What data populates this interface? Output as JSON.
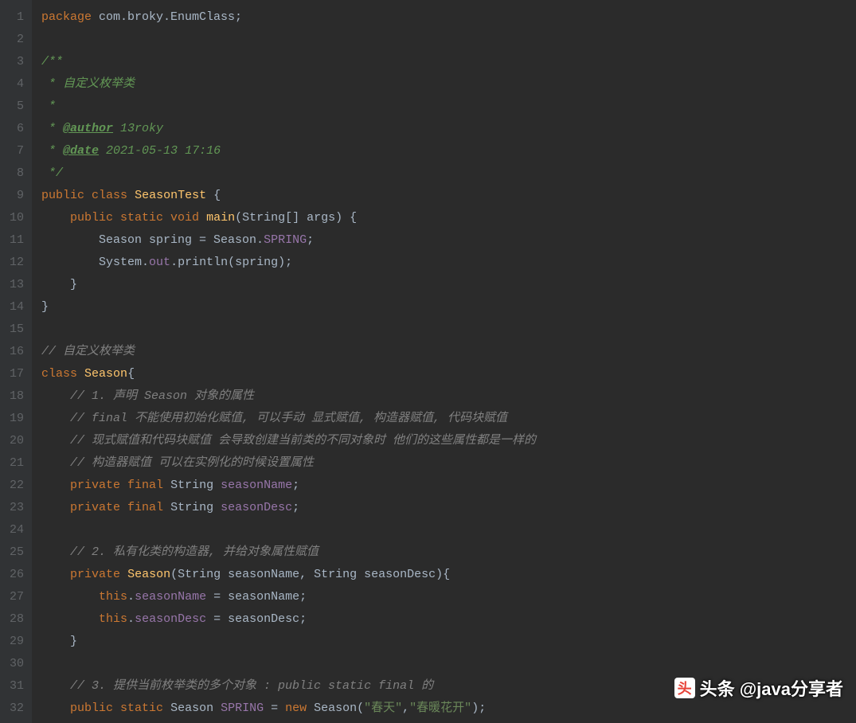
{
  "lines": [
    {
      "n": 1,
      "tokens": [
        {
          "c": "kw",
          "t": "package"
        },
        {
          "c": "pun",
          "t": " com.broky.EnumClass;"
        }
      ]
    },
    {
      "n": 2,
      "tokens": []
    },
    {
      "n": 3,
      "tokens": [
        {
          "c": "doc",
          "t": "/**"
        }
      ]
    },
    {
      "n": 4,
      "tokens": [
        {
          "c": "doc",
          "t": " * 自定义枚举类"
        }
      ]
    },
    {
      "n": 5,
      "tokens": [
        {
          "c": "doc",
          "t": " *"
        }
      ]
    },
    {
      "n": 6,
      "tokens": [
        {
          "c": "doc",
          "t": " * "
        },
        {
          "c": "doctag",
          "t": "@author"
        },
        {
          "c": "doc",
          "t": " 13roky"
        }
      ]
    },
    {
      "n": 7,
      "tokens": [
        {
          "c": "doc",
          "t": " * "
        },
        {
          "c": "doctag",
          "t": "@date"
        },
        {
          "c": "doc",
          "t": " 2021-05-13 17:16"
        }
      ]
    },
    {
      "n": 8,
      "tokens": [
        {
          "c": "doc",
          "t": " */"
        }
      ]
    },
    {
      "n": 9,
      "tokens": [
        {
          "c": "kw",
          "t": "public class"
        },
        {
          "c": "pun",
          "t": " "
        },
        {
          "c": "cls",
          "t": "SeasonTest"
        },
        {
          "c": "pun",
          "t": " {"
        }
      ]
    },
    {
      "n": 10,
      "tokens": [
        {
          "c": "pun",
          "t": "    "
        },
        {
          "c": "kw",
          "t": "public static void"
        },
        {
          "c": "pun",
          "t": " "
        },
        {
          "c": "fn",
          "t": "main"
        },
        {
          "c": "pun",
          "t": "(String[] args) {"
        }
      ]
    },
    {
      "n": 11,
      "tokens": [
        {
          "c": "pun",
          "t": "        Season spring = Season."
        },
        {
          "c": "field",
          "t": "SPRING"
        },
        {
          "c": "pun",
          "t": ";"
        }
      ]
    },
    {
      "n": 12,
      "tokens": [
        {
          "c": "pun",
          "t": "        System."
        },
        {
          "c": "field",
          "t": "out"
        },
        {
          "c": "pun",
          "t": ".println(spring);"
        }
      ]
    },
    {
      "n": 13,
      "tokens": [
        {
          "c": "pun",
          "t": "    }"
        }
      ]
    },
    {
      "n": 14,
      "tokens": [
        {
          "c": "pun",
          "t": "}"
        }
      ]
    },
    {
      "n": 15,
      "tokens": []
    },
    {
      "n": 16,
      "tokens": [
        {
          "c": "cmt",
          "t": "// 自定义枚举类"
        }
      ]
    },
    {
      "n": 17,
      "tokens": [
        {
          "c": "kw",
          "t": "class"
        },
        {
          "c": "pun",
          "t": " "
        },
        {
          "c": "cls",
          "t": "Season"
        },
        {
          "c": "pun",
          "t": "{"
        }
      ]
    },
    {
      "n": 18,
      "tokens": [
        {
          "c": "pun",
          "t": "    "
        },
        {
          "c": "cmt",
          "t": "// 1. 声明 Season 对象的属性"
        }
      ]
    },
    {
      "n": 19,
      "tokens": [
        {
          "c": "pun",
          "t": "    "
        },
        {
          "c": "cmt",
          "t": "// final 不能使用初始化赋值, 可以手动 显式赋值, 构造器赋值, 代码块赋值"
        }
      ]
    },
    {
      "n": 20,
      "tokens": [
        {
          "c": "pun",
          "t": "    "
        },
        {
          "c": "cmt",
          "t": "// 现式赋值和代码块赋值 会导致创建当前类的不同对象时 他们的这些属性都是一样的"
        }
      ]
    },
    {
      "n": 21,
      "tokens": [
        {
          "c": "pun",
          "t": "    "
        },
        {
          "c": "cmt",
          "t": "// 构造器赋值 可以在实例化的时候设置属性"
        }
      ]
    },
    {
      "n": 22,
      "tokens": [
        {
          "c": "pun",
          "t": "    "
        },
        {
          "c": "kw",
          "t": "private final"
        },
        {
          "c": "pun",
          "t": " String "
        },
        {
          "c": "field",
          "t": "seasonName"
        },
        {
          "c": "pun",
          "t": ";"
        }
      ]
    },
    {
      "n": 23,
      "tokens": [
        {
          "c": "pun",
          "t": "    "
        },
        {
          "c": "kw",
          "t": "private final"
        },
        {
          "c": "pun",
          "t": " String "
        },
        {
          "c": "field",
          "t": "seasonDesc"
        },
        {
          "c": "pun",
          "t": ";"
        }
      ]
    },
    {
      "n": 24,
      "tokens": []
    },
    {
      "n": 25,
      "tokens": [
        {
          "c": "pun",
          "t": "    "
        },
        {
          "c": "cmt",
          "t": "// 2. 私有化类的构造器, 并给对象属性赋值"
        }
      ]
    },
    {
      "n": 26,
      "tokens": [
        {
          "c": "pun",
          "t": "    "
        },
        {
          "c": "kw",
          "t": "private"
        },
        {
          "c": "pun",
          "t": " "
        },
        {
          "c": "cls",
          "t": "Season"
        },
        {
          "c": "pun",
          "t": "(String seasonName, String seasonDesc){"
        }
      ]
    },
    {
      "n": 27,
      "tokens": [
        {
          "c": "pun",
          "t": "        "
        },
        {
          "c": "kw",
          "t": "this"
        },
        {
          "c": "pun",
          "t": "."
        },
        {
          "c": "field",
          "t": "seasonName"
        },
        {
          "c": "pun",
          "t": " = seasonName;"
        }
      ]
    },
    {
      "n": 28,
      "tokens": [
        {
          "c": "pun",
          "t": "        "
        },
        {
          "c": "kw",
          "t": "this"
        },
        {
          "c": "pun",
          "t": "."
        },
        {
          "c": "field",
          "t": "seasonDesc"
        },
        {
          "c": "pun",
          "t": " = seasonDesc;"
        }
      ]
    },
    {
      "n": 29,
      "tokens": [
        {
          "c": "pun",
          "t": "    }"
        }
      ]
    },
    {
      "n": 30,
      "tokens": []
    },
    {
      "n": 31,
      "tokens": [
        {
          "c": "pun",
          "t": "    "
        },
        {
          "c": "cmt",
          "t": "// 3. 提供当前枚举类的多个对象 : public static final 的"
        }
      ]
    },
    {
      "n": 32,
      "tokens": [
        {
          "c": "pun",
          "t": "    "
        },
        {
          "c": "kw",
          "t": "public static"
        },
        {
          "c": "pun",
          "t": " Season "
        },
        {
          "c": "field",
          "t": "SPRING"
        },
        {
          "c": "pun",
          "t": " = "
        },
        {
          "c": "kw",
          "t": "new"
        },
        {
          "c": "pun",
          "t": " Season("
        },
        {
          "c": "str",
          "t": "\"春天\""
        },
        {
          "c": "pun",
          "t": ","
        },
        {
          "c": "str",
          "t": "\"春暖花开\""
        },
        {
          "c": "pun",
          "t": ");"
        }
      ]
    }
  ],
  "watermark": {
    "icon_text": "头",
    "label": "头条 @java分享者"
  }
}
